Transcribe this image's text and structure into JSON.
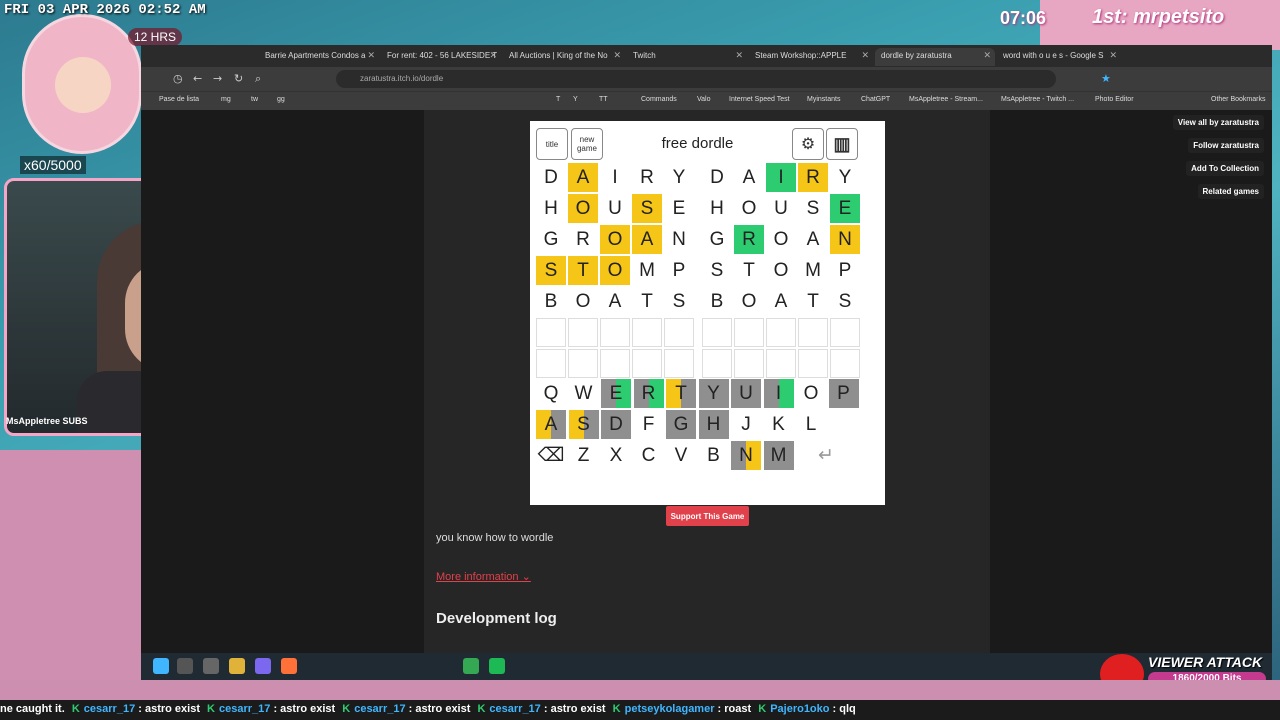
{
  "overlay": {
    "datetime": "FRI 03 APR 2026 02:52 AM",
    "hrs_badge": "12 HRS",
    "counter": "x60/5000",
    "subs_label": "MsAppletree SUBS",
    "timer": "07:06",
    "first": "1st: mrpetsito",
    "viewer_attack_title": "VIEWER ATTACK",
    "viewer_attack_bits": "1860/2000 Bits",
    "ticker": [
      {
        "name": "",
        "text": "ne caught it."
      },
      {
        "name": "cesarr_17",
        "text": ": astro exist"
      },
      {
        "name": "cesarr_17",
        "text": ": astro exist"
      },
      {
        "name": "cesarr_17",
        "text": ": astro exist"
      },
      {
        "name": "cesarr_17",
        "text": ": astro exist"
      },
      {
        "name": "petseykolagamer",
        "text": ": roast"
      },
      {
        "name": "Pajero1oko",
        "text": ": qlq"
      }
    ]
  },
  "browser": {
    "tabs": [
      {
        "label": "Barrie Apartments Condos a"
      },
      {
        "label": "For rent: 402 - 56 LAKESIDE T"
      },
      {
        "label": "All Auctions | King of the No"
      },
      {
        "label": "Twitch"
      },
      {
        "label": "Steam Workshop::APPLE"
      },
      {
        "label": "dordle by zaratustra"
      },
      {
        "label": "word with o u e s - Google S"
      }
    ],
    "url": "zaratustra.itch.io/dordle",
    "bookmarks": [
      "Pase de lista",
      "mg",
      "tw",
      "gg",
      "T",
      "Y",
      "TT",
      "Commands",
      "Valo",
      "Internet Speed Test",
      "Myinstants",
      "ChatGPT",
      "MsAppletree - Stream...",
      "MsAppletree - Twitch ...",
      "Photo Editor",
      "Other Bookmarks"
    ],
    "side": [
      "View all by zaratustra",
      "Follow zaratustra",
      "Add To Collection",
      "Related games"
    ]
  },
  "game": {
    "title_btn": "title",
    "new_game_btn": "new game",
    "title": "free dordle",
    "boards": [
      [
        [
          [
            "D",
            ""
          ],
          [
            "A",
            "y"
          ],
          [
            "I",
            ""
          ],
          [
            "R",
            ""
          ],
          [
            "Y",
            ""
          ]
        ],
        [
          [
            "H",
            ""
          ],
          [
            "O",
            "y"
          ],
          [
            "U",
            ""
          ],
          [
            "S",
            "y"
          ],
          [
            "E",
            ""
          ]
        ],
        [
          [
            "G",
            ""
          ],
          [
            "R",
            ""
          ],
          [
            "O",
            "y"
          ],
          [
            "A",
            "y"
          ],
          [
            "N",
            ""
          ]
        ],
        [
          [
            "S",
            "y"
          ],
          [
            "T",
            "y"
          ],
          [
            "O",
            "y"
          ],
          [
            "M",
            ""
          ],
          [
            "P",
            ""
          ]
        ],
        [
          [
            "B",
            ""
          ],
          [
            "O",
            ""
          ],
          [
            "A",
            ""
          ],
          [
            "T",
            ""
          ],
          [
            "S",
            ""
          ]
        ],
        [
          [
            "",
            ""
          ],
          [
            "",
            ""
          ],
          [
            "",
            ""
          ],
          [
            "",
            ""
          ],
          [
            "",
            ""
          ]
        ],
        [
          [
            "",
            ""
          ],
          [
            "",
            ""
          ],
          [
            "",
            ""
          ],
          [
            "",
            ""
          ],
          [
            "",
            ""
          ]
        ]
      ],
      [
        [
          [
            "D",
            ""
          ],
          [
            "A",
            ""
          ],
          [
            "I",
            "g"
          ],
          [
            "R",
            "y"
          ],
          [
            "Y",
            ""
          ]
        ],
        [
          [
            "H",
            ""
          ],
          [
            "O",
            ""
          ],
          [
            "U",
            ""
          ],
          [
            "S",
            ""
          ],
          [
            "E",
            "g"
          ]
        ],
        [
          [
            "G",
            ""
          ],
          [
            "R",
            "g"
          ],
          [
            "O",
            ""
          ],
          [
            "A",
            ""
          ],
          [
            "N",
            "y"
          ]
        ],
        [
          [
            "S",
            ""
          ],
          [
            "T",
            ""
          ],
          [
            "O",
            ""
          ],
          [
            "M",
            ""
          ],
          [
            "P",
            ""
          ]
        ],
        [
          [
            "B",
            ""
          ],
          [
            "O",
            ""
          ],
          [
            "A",
            ""
          ],
          [
            "T",
            ""
          ],
          [
            "S",
            ""
          ]
        ],
        [
          [
            "",
            ""
          ],
          [
            "",
            ""
          ],
          [
            "",
            ""
          ],
          [
            "",
            ""
          ],
          [
            "",
            ""
          ]
        ],
        [
          [
            "",
            ""
          ],
          [
            "",
            ""
          ],
          [
            "",
            ""
          ],
          [
            "",
            ""
          ],
          [
            "",
            ""
          ]
        ]
      ]
    ],
    "keyboard": [
      [
        [
          "Q",
          ""
        ],
        [
          "W",
          ""
        ],
        [
          "E",
          "gd"
        ],
        [
          "R",
          "dg"
        ],
        [
          "T",
          "yd"
        ],
        [
          "Y",
          "d"
        ],
        [
          "U",
          "d"
        ],
        [
          "I",
          "dg"
        ],
        [
          "O",
          "y"
        ],
        [
          "P",
          "d"
        ]
      ],
      [
        [
          "A",
          "yd"
        ],
        [
          "S",
          "yd"
        ],
        [
          "D",
          "d"
        ],
        [
          "F",
          ""
        ],
        [
          "G",
          "d"
        ],
        [
          "H",
          "d"
        ],
        [
          "J",
          ""
        ],
        [
          "K",
          ""
        ],
        [
          "L",
          ""
        ]
      ],
      [
        [
          "⌫",
          ""
        ],
        [
          "Z",
          ""
        ],
        [
          "X",
          ""
        ],
        [
          "C",
          ""
        ],
        [
          "V",
          ""
        ],
        [
          "B",
          ""
        ],
        [
          "N",
          "dy"
        ],
        [
          "M",
          "d"
        ],
        [
          "↵",
          ""
        ]
      ]
    ],
    "support_btn": "Support This Game",
    "description": "you know how to wordle",
    "more_info": "More information",
    "devlog": "Development log"
  }
}
